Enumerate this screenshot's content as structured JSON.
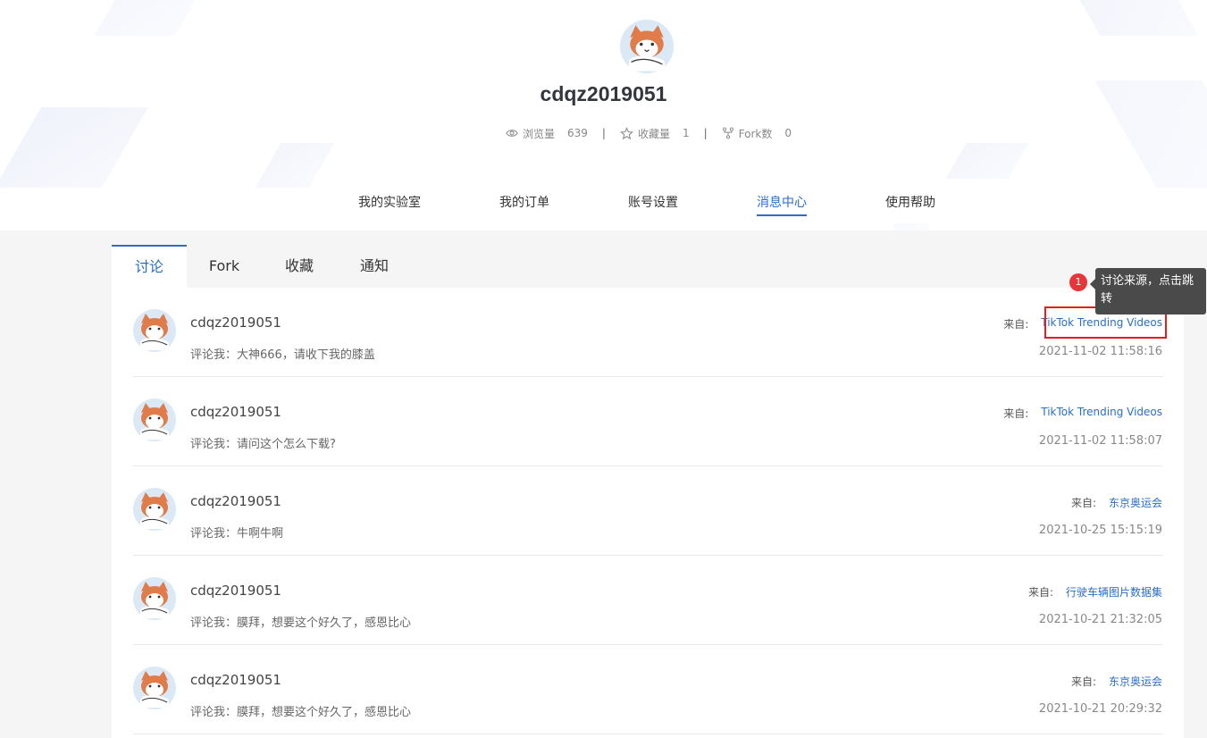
{
  "profile": {
    "username": "cdqz2019051",
    "stats": [
      {
        "icon": "eye-icon",
        "label": "浏览量",
        "value": "639"
      },
      {
        "icon": "star-icon",
        "label": "收藏量",
        "value": "1"
      },
      {
        "icon": "fork-icon",
        "label": "Fork数",
        "value": "0"
      }
    ],
    "separator": "|"
  },
  "nav": {
    "items": [
      {
        "label": "我的实验室"
      },
      {
        "label": "我的订单"
      },
      {
        "label": "账号设置"
      },
      {
        "label": "消息中心",
        "active": true
      },
      {
        "label": "使用帮助"
      }
    ]
  },
  "tabs": [
    {
      "label": "讨论",
      "active": true
    },
    {
      "label": "Fork"
    },
    {
      "label": "收藏"
    },
    {
      "label": "通知"
    }
  ],
  "messages": {
    "source_label": "来自:",
    "items": [
      {
        "name": "cdqz2019051",
        "comment": "评论我：大神666，请收下我的膝盖",
        "source": "TikTok Trending Videos",
        "time": "2021-11-02 11:58:16"
      },
      {
        "name": "cdqz2019051",
        "comment": "评论我：请问这个怎么下载?",
        "source": "TikTok Trending Videos",
        "time": "2021-11-02 11:58:07"
      },
      {
        "name": "cdqz2019051",
        "comment": "评论我：牛啊牛啊",
        "source": "东京奥运会",
        "time": "2021-10-25 15:15:19"
      },
      {
        "name": "cdqz2019051",
        "comment": "评论我：膜拜，想要这个好久了，感恩比心",
        "source": "行驶车辆图片数据集",
        "time": "2021-10-21 21:32:05"
      },
      {
        "name": "cdqz2019051",
        "comment": "评论我：膜拜，想要这个好久了，感恩比心",
        "source": "东京奥运会",
        "time": "2021-10-21 20:29:32"
      }
    ]
  },
  "annotation": {
    "badge": "1",
    "tooltip": "讨论来源，点击跳转"
  },
  "colors": {
    "accent": "#2a6ec8",
    "highlight": "#e02020",
    "badge": "#e8353a",
    "avatar_fur": "#e07b4a"
  }
}
